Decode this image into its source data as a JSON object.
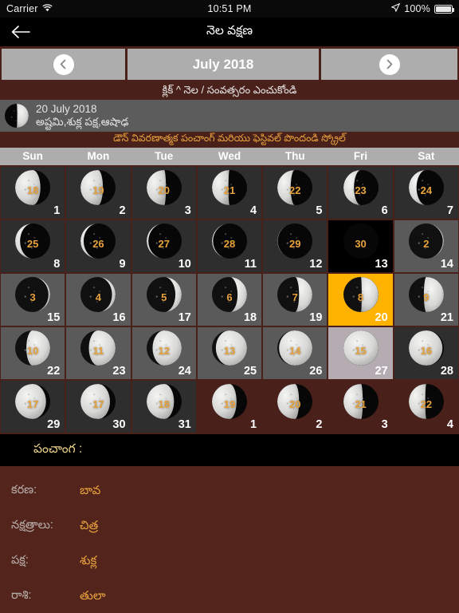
{
  "statusbar": {
    "carrier": "Carrier",
    "wifi_icon": "wifi-icon",
    "time": "10:51 PM",
    "location_icon": "location-arrow-icon",
    "battery": "100%"
  },
  "navbar": {
    "back_icon": "back-arrow-icon",
    "title": "నెల వక్షణ"
  },
  "monthbar": {
    "prev_icon": "chevron-left-icon",
    "next_icon": "chevron-right-icon",
    "month_label": "July 2018"
  },
  "hint": "క్లిక్ ^ నెల / సంవత్సరం ఎంచుకోండి",
  "moon_info": {
    "date": "20 July 2018",
    "tithi": "అష్టమి,శుక్ల పక్ష,ఆషాఢ",
    "moon_icon": "moon-phase-icon"
  },
  "scroll_hint": "డౌన్ వివరణాత్మక పంచాంగ్ మరియు ఫెస్టివల్ పొందండి స్క్రోల్",
  "weekdays": [
    "Sun",
    "Mon",
    "Tue",
    "Wed",
    "Thu",
    "Fri",
    "Sat"
  ],
  "colors": {
    "brand_maroon": "#4a201a",
    "panel_maroon": "#53241c",
    "accent_orange": "#e8a33d",
    "selected_bg": "#ffb300",
    "header_gray": "#adadad",
    "row_dark": "#2e2e2e",
    "row_light": "#5a5a5a",
    "fullmoon_bg": "#b5acb2",
    "newmoon_bg": "#000000"
  },
  "calendar": {
    "rows": [
      {
        "shade": "dark",
        "cells": [
          {
            "day": "1",
            "tithi": "18",
            "phase": 0.72,
            "waxing": false,
            "bg": "dark"
          },
          {
            "day": "2",
            "tithi": "19",
            "phase": 0.64,
            "waxing": false,
            "bg": "dark"
          },
          {
            "day": "3",
            "tithi": "20",
            "phase": 0.55,
            "waxing": false,
            "bg": "dark"
          },
          {
            "day": "4",
            "tithi": "21",
            "phase": 0.47,
            "waxing": false,
            "bg": "dark"
          },
          {
            "day": "5",
            "tithi": "22",
            "phase": 0.38,
            "waxing": false,
            "bg": "dark"
          },
          {
            "day": "6",
            "tithi": "23",
            "phase": 0.3,
            "waxing": false,
            "bg": "dark"
          },
          {
            "day": "7",
            "tithi": "24",
            "phase": 0.22,
            "waxing": false,
            "bg": "dark"
          }
        ]
      },
      {
        "shade": "dark",
        "cells": [
          {
            "day": "8",
            "tithi": "25",
            "phase": 0.14,
            "waxing": false,
            "bg": "dark"
          },
          {
            "day": "9",
            "tithi": "26",
            "phase": 0.09,
            "waxing": false,
            "bg": "dark"
          },
          {
            "day": "10",
            "tithi": "27",
            "phase": 0.05,
            "waxing": false,
            "bg": "dark"
          },
          {
            "day": "11",
            "tithi": "28",
            "phase": 0.03,
            "waxing": false,
            "bg": "dark"
          },
          {
            "day": "12",
            "tithi": "29",
            "phase": 0.01,
            "waxing": false,
            "bg": "dark"
          },
          {
            "day": "13",
            "tithi": "30",
            "phase": 0.0,
            "waxing": false,
            "bg": "newmoon"
          },
          {
            "day": "14",
            "tithi": "2",
            "phase": 0.03,
            "waxing": true,
            "bg": "light"
          }
        ]
      },
      {
        "shade": "light",
        "cells": [
          {
            "day": "15",
            "tithi": "3",
            "phase": 0.05,
            "waxing": true,
            "bg": "light"
          },
          {
            "day": "16",
            "tithi": "4",
            "phase": 0.1,
            "waxing": true,
            "bg": "light"
          },
          {
            "day": "17",
            "tithi": "5",
            "phase": 0.18,
            "waxing": true,
            "bg": "light"
          },
          {
            "day": "18",
            "tithi": "6",
            "phase": 0.27,
            "waxing": true,
            "bg": "light"
          },
          {
            "day": "19",
            "tithi": "7",
            "phase": 0.38,
            "waxing": true,
            "bg": "light"
          },
          {
            "day": "20",
            "tithi": "8",
            "phase": 0.48,
            "waxing": true,
            "bg": "selected"
          },
          {
            "day": "21",
            "tithi": "9",
            "phase": 0.57,
            "waxing": true,
            "bg": "light"
          }
        ]
      },
      {
        "shade": "light",
        "cells": [
          {
            "day": "22",
            "tithi": "10",
            "phase": 0.68,
            "waxing": true,
            "bg": "light"
          },
          {
            "day": "23",
            "tithi": "11",
            "phase": 0.76,
            "waxing": true,
            "bg": "light"
          },
          {
            "day": "24",
            "tithi": "12",
            "phase": 0.83,
            "waxing": true,
            "bg": "light"
          },
          {
            "day": "25",
            "tithi": "13",
            "phase": 0.89,
            "waxing": true,
            "bg": "light"
          },
          {
            "day": "26",
            "tithi": "14",
            "phase": 0.95,
            "waxing": true,
            "bg": "light"
          },
          {
            "day": "27",
            "tithi": "15",
            "phase": 1.0,
            "waxing": true,
            "bg": "fullmoon"
          },
          {
            "day": "28",
            "tithi": "16",
            "phase": 0.96,
            "waxing": false,
            "bg": "dark"
          }
        ]
      },
      {
        "shade": "dark",
        "cells": [
          {
            "day": "29",
            "tithi": "17",
            "phase": 0.88,
            "waxing": false,
            "bg": "dark"
          },
          {
            "day": "30",
            "tithi": "17",
            "phase": 0.84,
            "waxing": false,
            "bg": "dark"
          },
          {
            "day": "31",
            "tithi": "18",
            "phase": 0.78,
            "waxing": false,
            "bg": "dark"
          },
          {
            "day": "1",
            "tithi": "19",
            "phase": 0.7,
            "waxing": false,
            "bg": "other"
          },
          {
            "day": "2",
            "tithi": "20",
            "phase": 0.62,
            "waxing": false,
            "bg": "other"
          },
          {
            "day": "3",
            "tithi": "21",
            "phase": 0.55,
            "waxing": false,
            "bg": "other"
          },
          {
            "day": "4",
            "tithi": "22",
            "phase": 0.47,
            "waxing": false,
            "bg": "other"
          }
        ]
      }
    ]
  },
  "panchangam": {
    "title": "పంచాంగ :",
    "rows": [
      {
        "label": "కరణ:",
        "value": "బావ"
      },
      {
        "label": "నక్షత్రాలు:",
        "value": "చిత్ర"
      },
      {
        "label": "పక్ష:",
        "value": "శుక్ల"
      },
      {
        "label": "రాశి:",
        "value": "తులా"
      }
    ]
  }
}
